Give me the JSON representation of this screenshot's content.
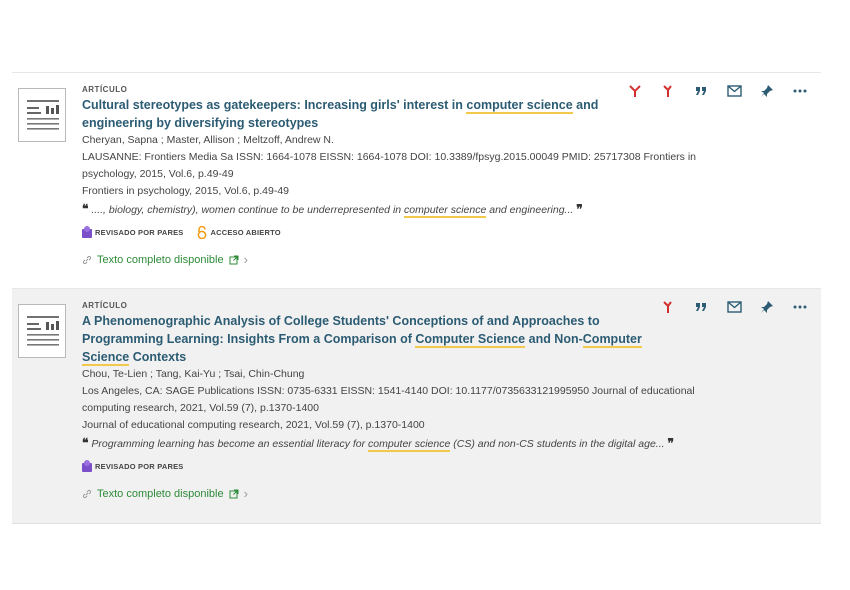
{
  "results": [
    {
      "type": "ARTÍCULO",
      "title_parts": {
        "t1": "Cultural stereotypes as gatekeepers: Increasing girls' interest in ",
        "t2": "computer science",
        "t3": " and engineering by diversifying stereotypes"
      },
      "authors": "Cheryan, Sapna ; Master, Allison ; Meltzoff, Andrew N.",
      "publication": "LAUSANNE: Frontiers Media Sa ISSN: 1664-1078 EISSN: 1664-1078 DOI: 10.3389/fpsyg.2015.00049 PMID: 25717308 Frontiers in psychology, 2015, Vol.6, p.49-49",
      "source": "Frontiers in psychology, 2015, Vol.6, p.49-49",
      "snippet_parts": {
        "s1": "...., biology, chemistry), women continue to be underrepresented in ",
        "s2": "computer science",
        "s3": " and engineering..."
      },
      "peer_reviewed": "REVISADO POR PARES",
      "open_access": "ACCESO ABIERTO",
      "fulltext": "Texto completo disponible"
    },
    {
      "type": "ARTÍCULO",
      "title_parts": {
        "t1": "A Phenomenographic Analysis of College Students' Conceptions of and Approaches to Programming Learning: Insights From a Comparison of ",
        "t2": "Computer Science",
        "t3": " and Non-",
        "t4": "Computer Science",
        "t5": " Contexts"
      },
      "authors": "Chou, Te-Lien ; Tang, Kai-Yu ; Tsai, Chin-Chung",
      "publication": "Los Angeles, CA: SAGE Publications ISSN: 0735-6331 EISSN: 1541-4140 DOI: 10.1177/0735633121995950 Journal of educational computing research, 2021, Vol.59 (7), p.1370-1400",
      "source": "Journal of educational computing research, 2021, Vol.59 (7), p.1370-1400",
      "snippet_parts": {
        "s1": "Programming learning has become an essential literacy for ",
        "s2": "computer science",
        "s3": " (CS) and non-CS students in the digital age..."
      },
      "peer_reviewed": "REVISADO POR PARES",
      "fulltext": "Texto completo disponible"
    }
  ],
  "glyphs": {
    "quote_open": "❝",
    "quote_close": "❞",
    "chevron": "›"
  },
  "colors": {
    "title": "#2c5c73",
    "action_red": "#d32f2f",
    "action_dark": "#2c5c73",
    "fulltext": "#2e8b3a",
    "peer_purple": "#7b4fc9",
    "open_orange": "#f39c12",
    "highlight": "#f2c94c"
  }
}
